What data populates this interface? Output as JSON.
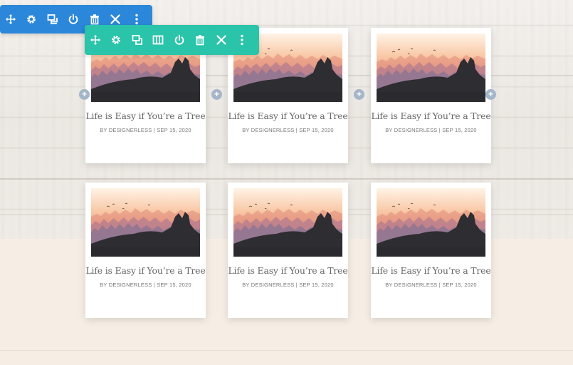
{
  "row_toolbar": {
    "color": "#2b87da",
    "icons": [
      "move-icon",
      "gear-icon",
      "duplicate-icon",
      "power-icon",
      "trash-icon",
      "close-icon",
      "more-icon"
    ]
  },
  "section_toolbar": {
    "color": "#29c4a9",
    "icons": [
      "move-icon",
      "gear-icon",
      "duplicate-icon",
      "columns-icon",
      "power-icon",
      "trash-icon",
      "close-icon",
      "more-icon"
    ]
  },
  "add_button_label": "+",
  "posts": [
    {
      "title": "Life is Easy if You’re a Tree",
      "meta": "BY DESIGNERLESS | SEP 15, 2020"
    },
    {
      "title": "Life is Easy if You’re a Tree",
      "meta": "BY DESIGNERLESS | SEP 15, 2020"
    },
    {
      "title": "Life is Easy if You’re a Tree",
      "meta": "BY DESIGNERLESS | SEP 15, 2020"
    },
    {
      "title": "Life is Easy if You’re a Tree",
      "meta": "BY DESIGNERLESS | SEP 15, 2020"
    },
    {
      "title": "Life is Easy if You’re a Tree",
      "meta": "BY DESIGNERLESS | SEP 15, 2020"
    },
    {
      "title": "Life is Easy if You’re a Tree",
      "meta": "BY DESIGNERLESS | SEP 15, 2020"
    }
  ]
}
